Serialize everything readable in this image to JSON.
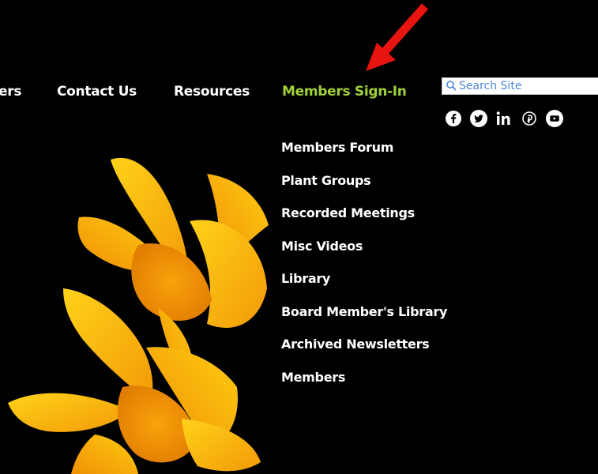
{
  "nav": {
    "items": [
      {
        "label": "ers"
      },
      {
        "label": "Contact Us"
      },
      {
        "label": "Resources"
      },
      {
        "label": "Members Sign-In"
      }
    ],
    "active_color": "#9fd13a"
  },
  "dropdown": {
    "items": [
      "Members Forum",
      "Plant Groups",
      "Recorded Meetings",
      "Misc Videos",
      "Library",
      "Board Member's Library",
      "Archived Newsletters",
      "Members"
    ]
  },
  "search": {
    "placeholder": "Search Site",
    "value": ""
  },
  "social_icons": [
    "facebook-icon",
    "twitter-icon",
    "linkedin-icon",
    "pinterest-icon",
    "youtube-icon"
  ],
  "annotation_arrow_color": "#e8140f",
  "background": "#000000"
}
